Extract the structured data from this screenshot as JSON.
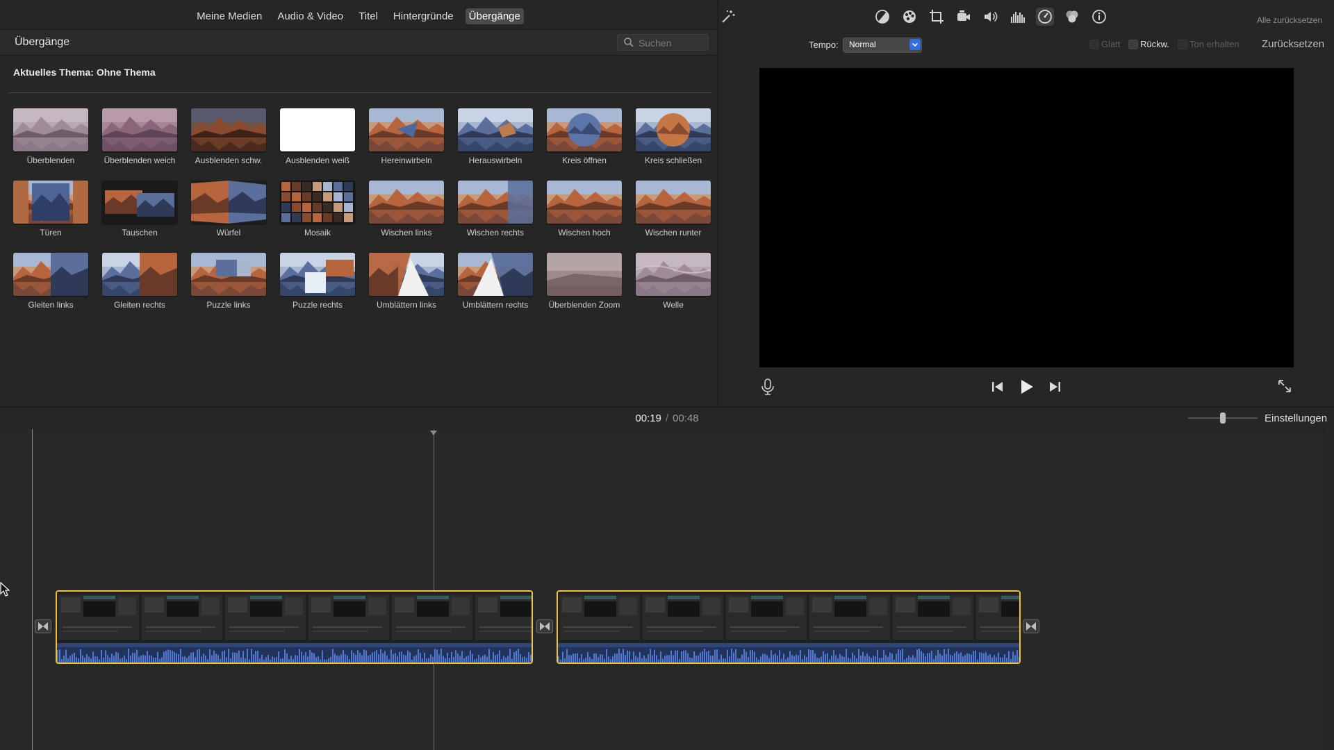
{
  "media_tabs": [
    {
      "label": "Meine Medien",
      "active": false
    },
    {
      "label": "Audio & Video",
      "active": false
    },
    {
      "label": "Titel",
      "active": false
    },
    {
      "label": "Hintergründe",
      "active": false
    },
    {
      "label": "Übergänge",
      "active": true
    }
  ],
  "browser": {
    "title": "Übergänge",
    "search_placeholder": "Suchen",
    "theme_label": "Aktuelles Thema: Ohne Thema"
  },
  "transitions": [
    {
      "label": "Überblenden",
      "style": "mist"
    },
    {
      "label": "Überblenden weich",
      "style": "soft"
    },
    {
      "label": "Ausblenden schw.",
      "style": "dark"
    },
    {
      "label": "Ausblenden weiß",
      "style": "white"
    },
    {
      "label": "Hereinwirbeln",
      "style": "swirl"
    },
    {
      "label": "Herauswirbeln",
      "style": "blue"
    },
    {
      "label": "Kreis öffnen",
      "style": "circle"
    },
    {
      "label": "Kreis schließen",
      "style": "circle-close"
    },
    {
      "label": "Türen",
      "style": "doors"
    },
    {
      "label": "Tauschen",
      "style": "swap"
    },
    {
      "label": "Würfel",
      "style": "cube"
    },
    {
      "label": "Mosaik",
      "style": "mosaic"
    },
    {
      "label": "Wischen links",
      "style": "wipe"
    },
    {
      "label": "Wischen rechts",
      "style": "wipe-right"
    },
    {
      "label": "Wischen hoch",
      "style": "wipe"
    },
    {
      "label": "Wischen runter",
      "style": "wipe"
    },
    {
      "label": "Gleiten links",
      "style": "slide"
    },
    {
      "label": "Gleiten rechts",
      "style": "slide-right"
    },
    {
      "label": "Puzzle links",
      "style": "puzzle"
    },
    {
      "label": "Puzzle rechts",
      "style": "puzzle-right"
    },
    {
      "label": "Umblättern links",
      "style": "page"
    },
    {
      "label": "Umblättern rechts",
      "style": "page-right"
    },
    {
      "label": "Überblenden Zoom",
      "style": "zoom"
    },
    {
      "label": "Welle",
      "style": "wave"
    }
  ],
  "viewer": {
    "reset_all": "Alle zurücksetzen",
    "tempo_label": "Tempo:",
    "tempo_value": "Normal",
    "options": [
      {
        "label": "Glatt",
        "enabled": false
      },
      {
        "label": "Rückw.",
        "enabled": true
      },
      {
        "label": "Ton erhalten",
        "enabled": false
      }
    ],
    "reset": "Zurücksetzen",
    "toolbar_icons": [
      "magic-wand-icon",
      "color-balance-icon",
      "color-correction-icon",
      "crop-icon",
      "stabilization-icon",
      "volume-icon",
      "noise-reduction-icon",
      "speed-icon",
      "clip-filter-icon",
      "info-icon"
    ]
  },
  "timeline": {
    "current_time": "00:19",
    "separator": "/",
    "total_time": "00:48",
    "settings_label": "Einstellungen",
    "zoom_level": 0.5
  },
  "colors": {
    "accent_blue": "#2d6fe0",
    "clip_border": "#f2c12e",
    "background": "#262626"
  }
}
